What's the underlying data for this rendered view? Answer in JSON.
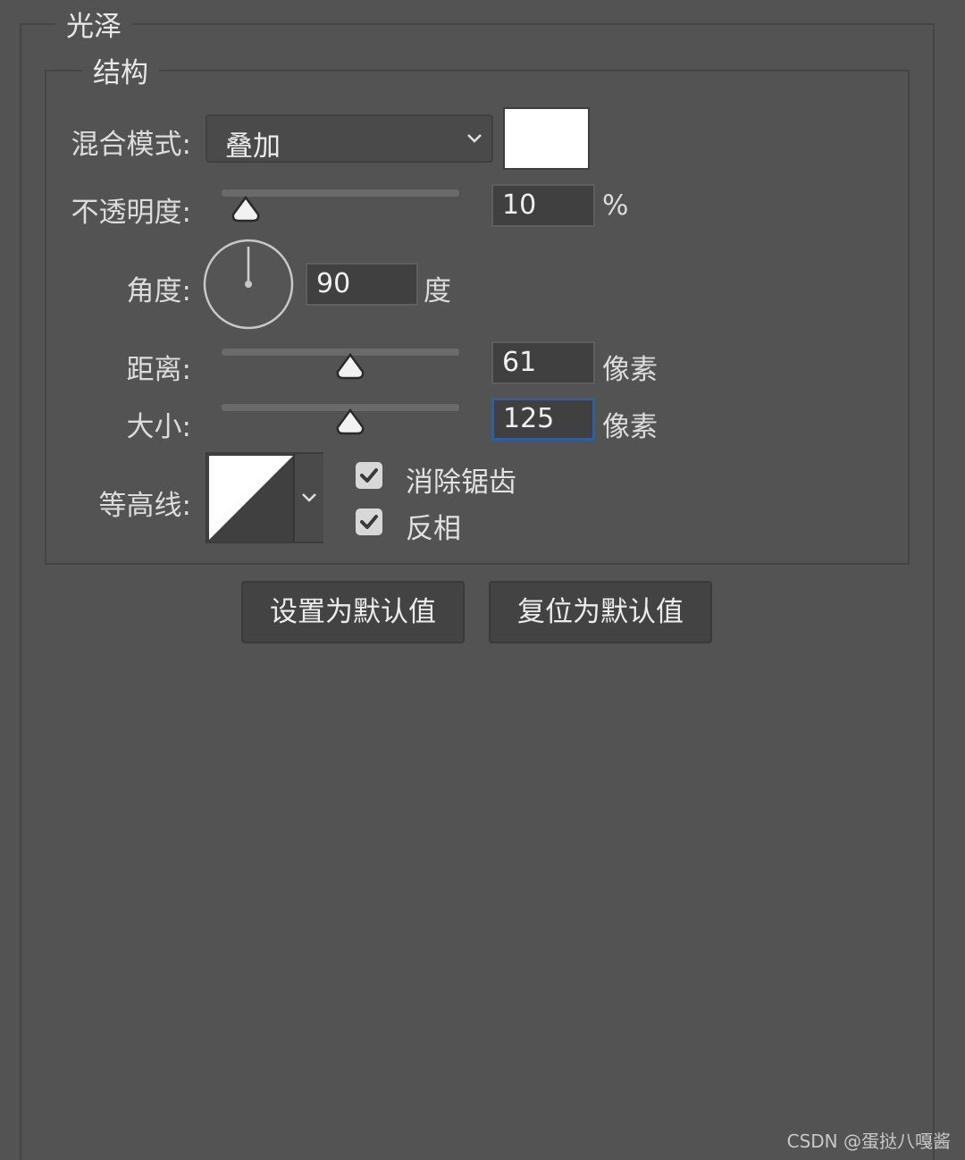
{
  "panel": {
    "section_title": "光泽",
    "group_title": "结构"
  },
  "blend_mode": {
    "label": "混合模式:",
    "value": "叠加",
    "color": "#ffffff",
    "icon": "chevron-down-icon"
  },
  "opacity": {
    "label": "不透明度:",
    "value": "10",
    "unit": "%",
    "slider_level_percent": 10
  },
  "angle": {
    "label": "角度:",
    "value": "90",
    "unit": "度",
    "dial_degrees": 90
  },
  "distance": {
    "label": "距离:",
    "value": "61",
    "unit": "像素",
    "slider_level_percent": 54
  },
  "size": {
    "label": "大小:",
    "value": "125",
    "unit": "像素",
    "slider_level_percent": 54
  },
  "contour": {
    "label": "等高线:",
    "icon": "chevron-down-icon"
  },
  "options": {
    "anti_alias": {
      "label": "消除锯齿",
      "checked": true
    },
    "invert": {
      "label": "反相",
      "checked": true
    }
  },
  "buttons": {
    "set_default": "设置为默认值",
    "reset_default": "复位为默认值"
  },
  "watermark": "CSDN @蛋挞八嘎酱"
}
